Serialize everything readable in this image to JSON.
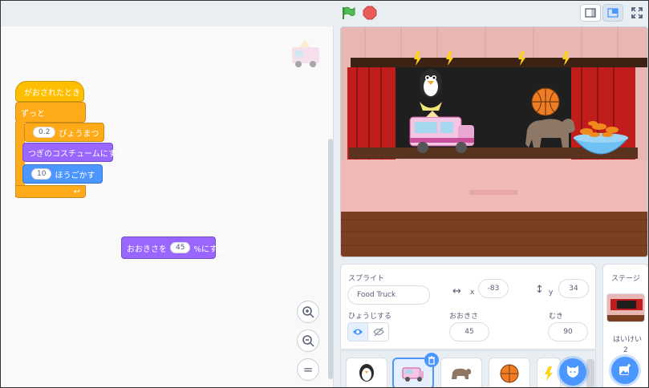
{
  "code": {
    "hat_label": "がおされたとき",
    "forever_label": "ずっと",
    "wait_value": "0.2",
    "wait_label": "びょうまつ",
    "next_costume_label": "つぎのコスチュームにする",
    "move_value": "10",
    "move_label": "ほうごかす",
    "size_label_before": "おおきさを",
    "size_value": "45",
    "size_label_after": "%にする"
  },
  "zoom": {
    "in_icon": "zoom-in-icon",
    "out_icon": "zoom-out-icon",
    "reset_label": "="
  },
  "sprite_info": {
    "section_label": "スプライト",
    "name_value": "Food Truck",
    "x_label": "x",
    "x_value": "-83",
    "y_label": "y",
    "y_value": "34",
    "show_label": "ひょうじする",
    "size_label": "おおきさ",
    "size_value": "45",
    "direction_label": "むき",
    "direction_value": "90"
  },
  "stage_pane": {
    "title": "ステージ",
    "backdrop_label": "はいけい",
    "backdrop_count": "2"
  },
  "colors": {
    "accent": "#4c97ff",
    "events": "#ffbf00",
    "control": "#ffab19",
    "looks": "#9966ff",
    "motion": "#4c97ff"
  }
}
